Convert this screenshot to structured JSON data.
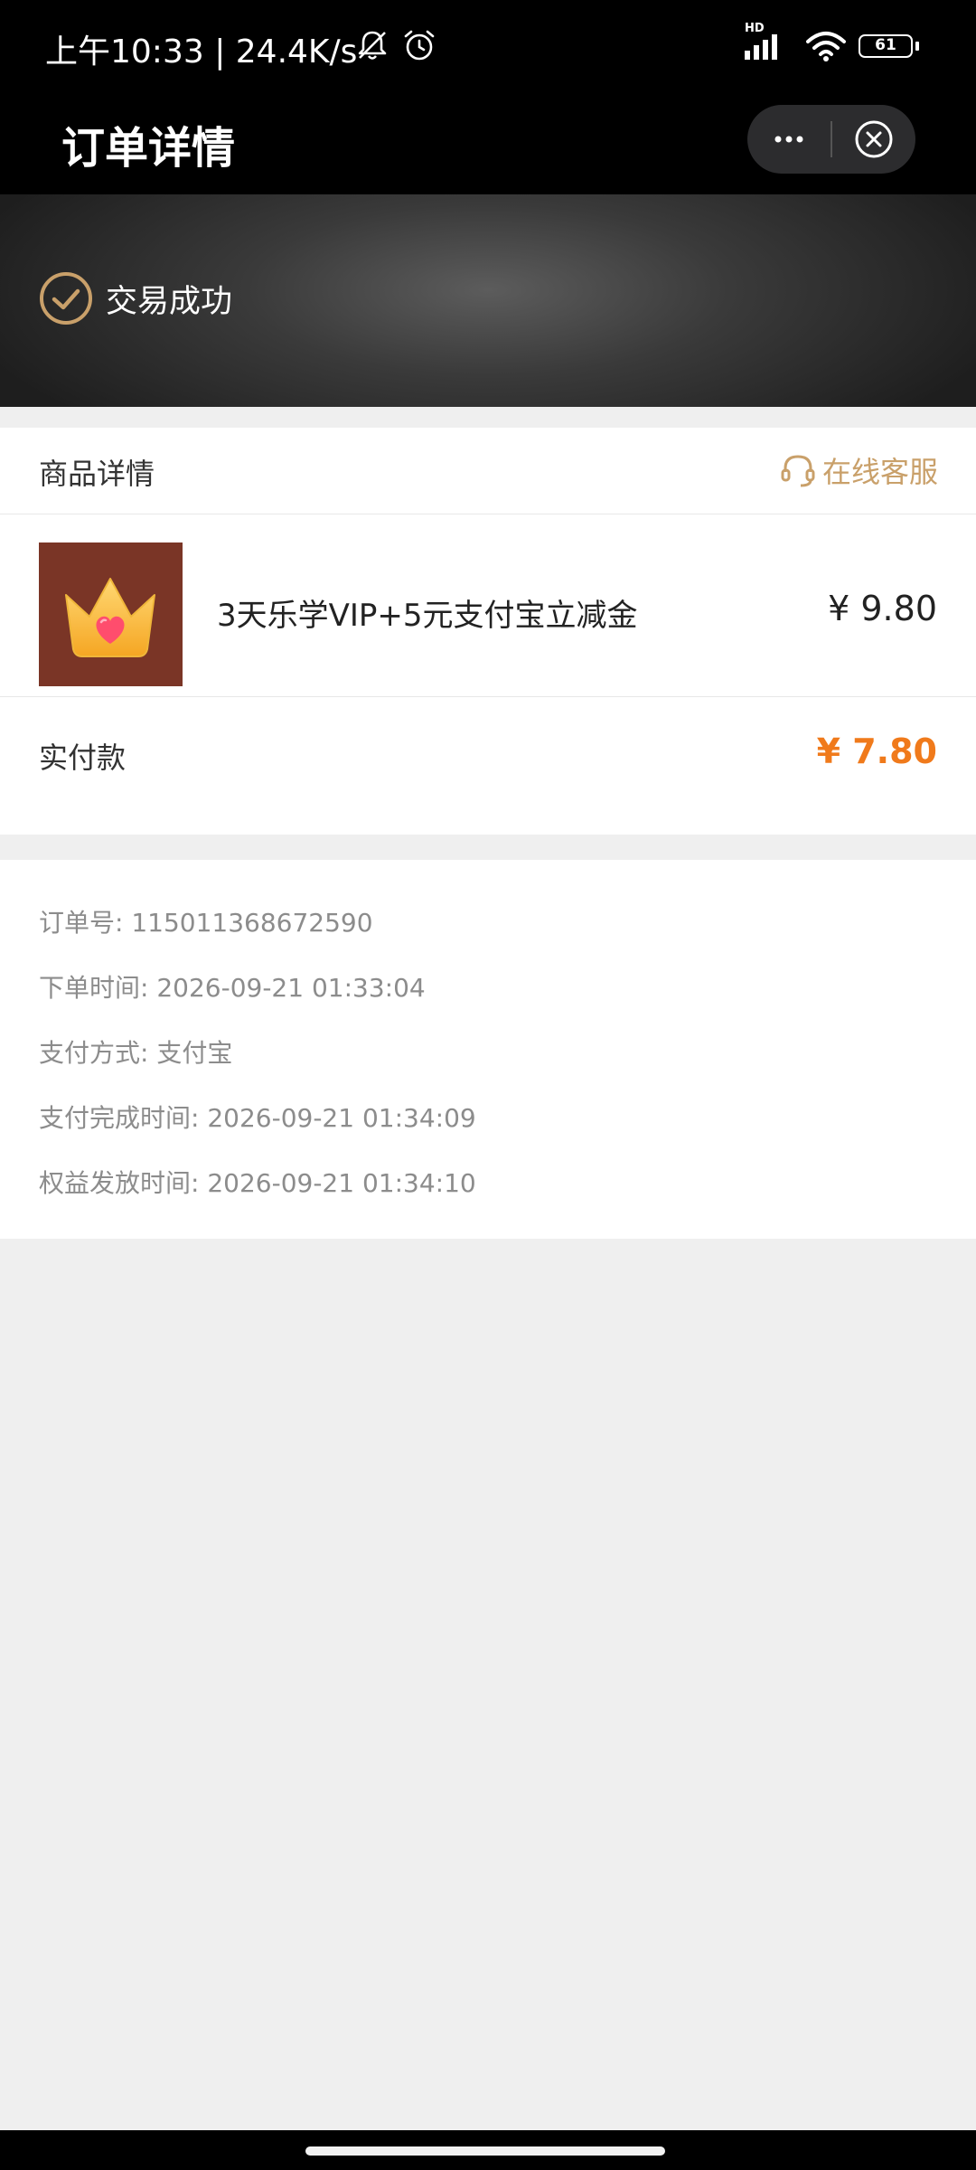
{
  "status_bar": {
    "time": "上午10:33 | 24.4K/s",
    "battery": "61",
    "network_label": "HD"
  },
  "header": {
    "title": "订单详情"
  },
  "banner": {
    "status": "交易成功"
  },
  "product_section": {
    "title": "商品详情",
    "service_label": "在线客服",
    "product_name": "3天乐学VIP+5元支付宝立减金",
    "product_price": "¥ 9.80",
    "paid_label": "实付款",
    "paid_amount": "¥ 7.80"
  },
  "order_info": {
    "lines": [
      "订单号: 115011368672590",
      "下单时间: 2026-09-21 01:33:04",
      "支付方式: 支付宝",
      "支付完成时间: 2026-09-21 01:34:09",
      "权益发放时间: 2026-09-21 01:34:10"
    ]
  },
  "colors": {
    "accent_gold": "#c9a06a",
    "price_orange": "#f07a1b",
    "thumb_bg": "#7a3526"
  },
  "icons": {
    "check": "check-circle-icon",
    "headset": "headset-icon",
    "crown": "crown-heart-icon",
    "more": "more-dots-icon",
    "close": "close-circle-icon"
  }
}
